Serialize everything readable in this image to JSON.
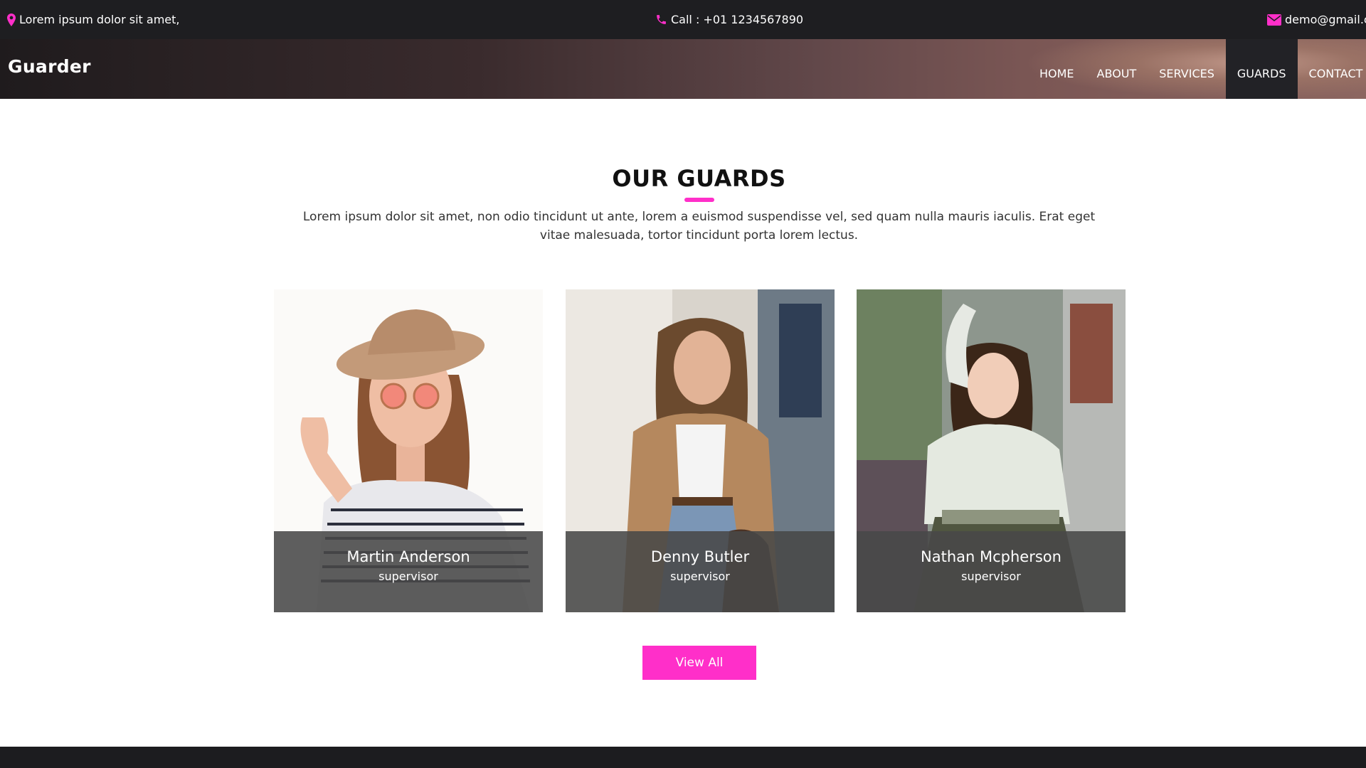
{
  "topbar": {
    "address": "Lorem ipsum dolor sit amet,",
    "phone": "Call : +01 1234567890",
    "email": "demo@gmail.com"
  },
  "header": {
    "brand": "Guarder",
    "nav": [
      {
        "label": "HOME"
      },
      {
        "label": "ABOUT"
      },
      {
        "label": "SERVICES"
      },
      {
        "label": "GUARDS",
        "active": true
      },
      {
        "label": "CONTACT US"
      }
    ]
  },
  "section": {
    "title": "OUR GUARDS",
    "description": "Lorem ipsum dolor sit amet, non odio tincidunt ut ante, lorem a euismod suspendisse vel, sed quam nulla mauris iaculis. Erat eget vitae malesuada, tortor tincidunt porta lorem lectus."
  },
  "guards": [
    {
      "name": "Martin Anderson",
      "role": "supervisor"
    },
    {
      "name": "Denny Butler",
      "role": "supervisor"
    },
    {
      "name": "Nathan Mcpherson",
      "role": "supervisor"
    }
  ],
  "view_all_label": "View All",
  "colors": {
    "accent": "#ff2fc9",
    "topbar": "#1e1e21",
    "active_nav": "#222226"
  },
  "icons": {
    "address": "map-pin-icon",
    "phone": "phone-icon",
    "email": "envelope-icon"
  }
}
